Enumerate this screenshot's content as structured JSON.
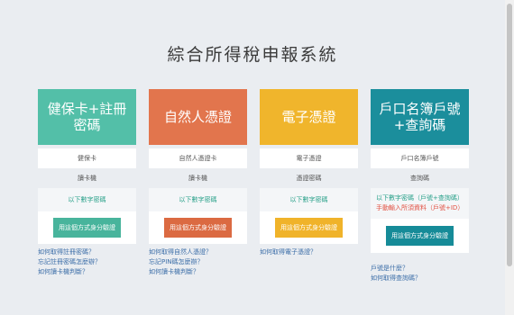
{
  "title": "綜合所得稅申報系統",
  "columns": [
    {
      "header": "健保卡+註冊密碼",
      "row1": "健保卡",
      "row2": "讀卡機",
      "row3": "以下數字密碼",
      "button": "用這個方式身分驗證",
      "links": [
        "如何取得註冊密碼？",
        "忘記註冊密碼怎麼辦？",
        "如何讀卡機判斷？"
      ]
    },
    {
      "header": "自然人憑證",
      "row1": "自然人憑證卡",
      "row2": "讀卡機",
      "row3": "以下數字密碼",
      "button": "用這個方式身分驗證",
      "links": [
        "如何取得自然人憑證？",
        "忘記PIN碼怎麼辦？",
        "如何讀卡機判斷？"
      ]
    },
    {
      "header": "電子憑證",
      "row1": "電子憑證",
      "row2": "憑證密碼",
      "row3": "以下數字密碼",
      "button": "用這個方式身分驗證",
      "links": [
        "如何取得電子憑證？"
      ]
    },
    {
      "header": "戶口名簿戶號+查詢碼",
      "row1": "戶口名簿戶號",
      "row2": "查詢碼",
      "note_green": "以下數字密碼（戶號+查詢碼）",
      "note_red": "手動輸入所須資料（戶號+ID）",
      "button": "用這個方式身分驗證",
      "links": [
        "戶號是什麼？",
        "如何取得查詢碼？"
      ]
    }
  ]
}
